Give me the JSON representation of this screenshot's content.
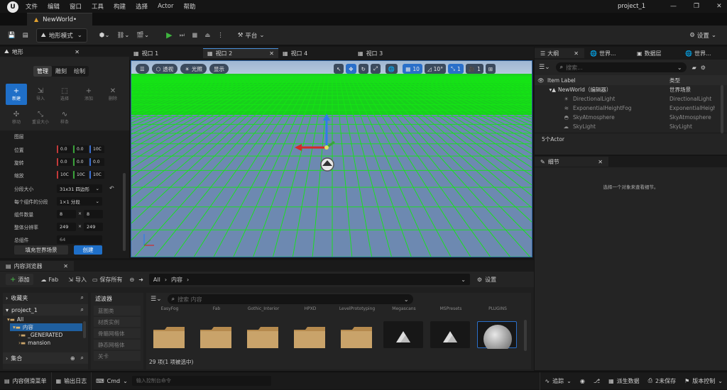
{
  "menu": [
    "文件",
    "编辑",
    "窗口",
    "工具",
    "构建",
    "选择",
    "Actor",
    "帮助"
  ],
  "project_name": "project_1",
  "document_tab": "NewWorld•",
  "toolbar": {
    "mode_label": "地形模式",
    "platform_label": "平台",
    "settings_label": "设置"
  },
  "landscape_panel": {
    "title": "地形",
    "modes": [
      "管理",
      "雕刻",
      "绘制"
    ],
    "tools": [
      {
        "label": "新建",
        "glyph": "+"
      },
      {
        "label": "导入",
        "glyph": "⇲"
      },
      {
        "label": "选择",
        "glyph": "⬚"
      },
      {
        "label": "添加",
        "glyph": "+"
      },
      {
        "label": "删除",
        "glyph": "✕"
      },
      {
        "label": "移动",
        "glyph": "✣"
      },
      {
        "label": "重设大小",
        "glyph": "⤡"
      },
      {
        "label": "样条",
        "glyph": "∿"
      }
    ],
    "layer_label": "图层",
    "location_label": "位置",
    "location": [
      "0.0",
      "0.0",
      "10C"
    ],
    "rotation_label": "旋转",
    "rotation": [
      "0.0",
      "0.0",
      "0.0"
    ],
    "scale_label": "缩放",
    "scale": [
      "10C",
      "10C",
      "10C"
    ],
    "section_size_label": "分段大小",
    "section_size": "31x31 四边形",
    "sections_per_component_label": "每个组件的分段",
    "sections_per_component": "1×1 分段",
    "component_count_label": "组件数量",
    "component_count": [
      "8",
      "8"
    ],
    "overall_resolution_label": "整体分辨率",
    "overall_resolution": [
      "249",
      "249"
    ],
    "total_components_label": "总组件",
    "total_components": "64",
    "fill_world_label": "填充世界场景",
    "create_label": "创建"
  },
  "viewport_tabs": [
    "视口 1",
    "视口 2",
    "视口 4",
    "视口 3"
  ],
  "viewport_bar": {
    "perspective": "透视",
    "lighting": "光照",
    "show": "显示",
    "grid_snap": "10",
    "rotation_snap": "10°",
    "scale_snap": "1",
    "camera_speed": "1"
  },
  "outliner": {
    "tabs": [
      "大纲",
      "世界...",
      "数据层",
      "世界..."
    ],
    "search_placeholder": "搜索...",
    "col_label": "Item Label",
    "col_type": "类型",
    "rows": [
      {
        "label": "NewWorld（编辑器）",
        "type": "世界场景"
      },
      {
        "label": "DirectionalLight",
        "type": "DirectionalLight"
      },
      {
        "label": "ExponentialHeightFog",
        "type": "ExponentialHeightFog"
      },
      {
        "label": "SkyAtmosphere",
        "type": "SkyAtmosphere"
      },
      {
        "label": "SkyLight",
        "type": "SkyLight"
      }
    ],
    "count": "5个Actor"
  },
  "details": {
    "title": "细节",
    "empty_message": "选择一个对象来查看细节。"
  },
  "content_browser": {
    "title": "内容浏览器",
    "add_label": "添加",
    "fab_label": "Fab",
    "import_label": "导入",
    "save_all_label": "保存所有",
    "path": [
      "All",
      "内容"
    ],
    "settings_label": "设置",
    "favorites_label": "收藏夹",
    "project_label": "project_1",
    "tree": [
      "All",
      "内容",
      "_GENERATED",
      "mansion"
    ],
    "collections_label": "集合",
    "filters_label": "滤波器",
    "filters": [
      "蓝图类",
      "材质实例",
      "骨骼网格体",
      "静态网格体",
      "关卡"
    ],
    "search_placeholder": "搜索 内容",
    "asset_names": [
      "EasyFog",
      "Fab",
      "Gothic_Interior",
      "HPXD",
      "LevelPrototyping",
      "Megascans",
      "MSPresets",
      "PLUGINS"
    ],
    "status": "29 项(1 项被选中)"
  },
  "statusbar": {
    "drawer": "内容侧滑菜单",
    "output": "输出日志",
    "cmd": "Cmd",
    "cmd_placeholder": "输入控制台命令",
    "trace": "追踪",
    "derived_data": "派生数据",
    "unsaved": "2未保存",
    "source_control": "版本控制"
  },
  "colors": {
    "accent": "#1f6fc8",
    "grid": "#14e614",
    "sky": "#b4c8de",
    "ground": "#6d89b1"
  }
}
